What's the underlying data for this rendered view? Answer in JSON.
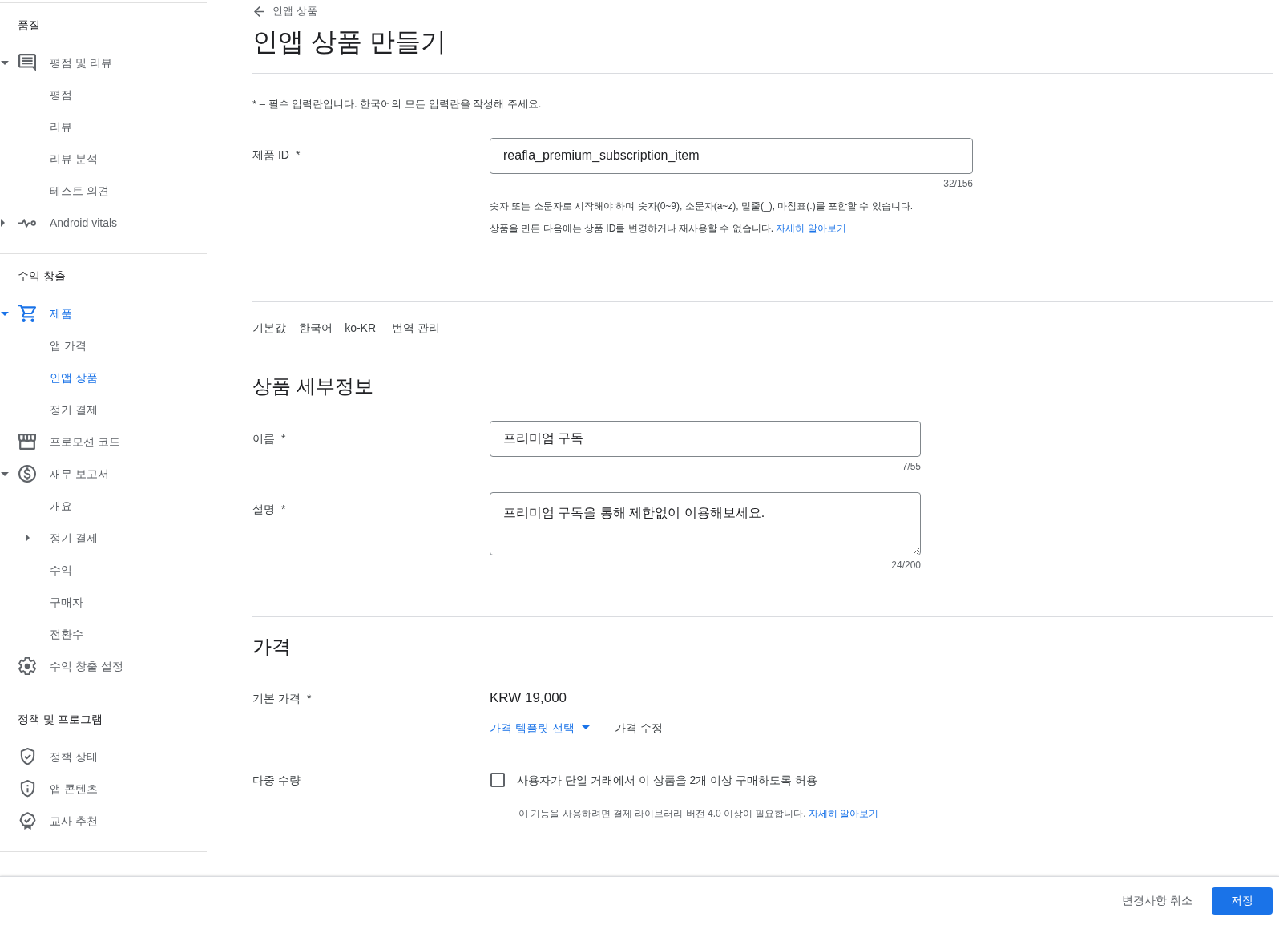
{
  "sidebar": {
    "sections": [
      {
        "title": "품질",
        "items": [
          {
            "label": "평점 및 리뷰",
            "selected": false,
            "expanded": true,
            "children": [
              {
                "label": "평점",
                "selected": false
              },
              {
                "label": "리뷰",
                "selected": false
              },
              {
                "label": "리뷰 분석",
                "selected": false
              },
              {
                "label": "테스트 의견",
                "selected": false
              }
            ]
          },
          {
            "label": "Android vitals",
            "selected": false,
            "expanded": false
          }
        ]
      },
      {
        "title": "수익 창출",
        "items": [
          {
            "label": "제품",
            "selected": true,
            "expanded": true,
            "children": [
              {
                "label": "앱 가격",
                "selected": false
              },
              {
                "label": "인앱 상품",
                "selected": true
              },
              {
                "label": "정기 결제",
                "selected": false
              }
            ]
          },
          {
            "label": "프로모션 코드",
            "selected": false
          },
          {
            "label": "재무 보고서",
            "selected": false,
            "expanded": true,
            "children": [
              {
                "label": "개요",
                "selected": false
              },
              {
                "label": "정기 결제",
                "selected": false,
                "expanded": false
              },
              {
                "label": "수익",
                "selected": false
              },
              {
                "label": "구매자",
                "selected": false
              },
              {
                "label": "전환수",
                "selected": false
              }
            ]
          },
          {
            "label": "수익 창출 설정",
            "selected": false
          }
        ]
      },
      {
        "title": "정책 및 프로그램",
        "items": [
          {
            "label": "정책 상태",
            "selected": false
          },
          {
            "label": "앱 콘텐츠",
            "selected": false
          },
          {
            "label": "교사 추천",
            "selected": false
          }
        ]
      }
    ]
  },
  "back_link": {
    "label": "인앱 상품"
  },
  "title": "인앱 상품 만들기",
  "required_note": "* – 필수 입력란입니다. 한국어의 모든 입력란을 작성해 주세요.",
  "product_id": {
    "label": "제품 ID",
    "required_mark": "*",
    "value": "reafla_premium_subscription_item",
    "counter": "32/156",
    "help": [
      {
        "text": "숫자 또는 소문자로 시작해야 하며 숫자(0~9), 소문자(a~z), 밑줄(_), 마침표(.)를 포함할 수 있습니다."
      },
      {
        "text": "상품을 만든 다음에는 상품 ID를 변경하거나 재사용할 수 없습니다.",
        "link": "자세히 알아보기"
      }
    ]
  },
  "language": {
    "default": "기본값 – 한국어 – ko-KR",
    "manage_translations": "번역 관리"
  },
  "details": {
    "heading": "상품 세부정보",
    "fields": [
      {
        "kind": "input",
        "label": "이름",
        "required_mark": "*",
        "value": "프리미엄 구독",
        "counter": "7/55"
      },
      {
        "kind": "textarea",
        "label": "설명",
        "required_mark": "*",
        "value": "프리미엄 구독을 통해 제한없이 이용해보세요.",
        "counter": "24/200"
      }
    ]
  },
  "pricing": {
    "heading": "가격",
    "base_price": {
      "label": "기본 가격",
      "required_mark": "*",
      "value": "KRW 19,000",
      "template_button": "가격 템플릿 선택",
      "edit_button": "가격 수정"
    },
    "multi_quantity": {
      "label": "다중 수량",
      "checkbox_label": "사용자가 단일 거래에서 이 상품을 2개 이상 구매하도록 허용",
      "checked": false,
      "note": "이 기능을 사용하려면 결제 라이브러리 버전 4.0 이상이 필요합니다.",
      "link": "자세히 알아보기"
    }
  },
  "footer": {
    "buttons": [
      {
        "kind": "text",
        "label": "변경사항 취소"
      },
      {
        "kind": "primary",
        "label": "저장"
      }
    ]
  }
}
